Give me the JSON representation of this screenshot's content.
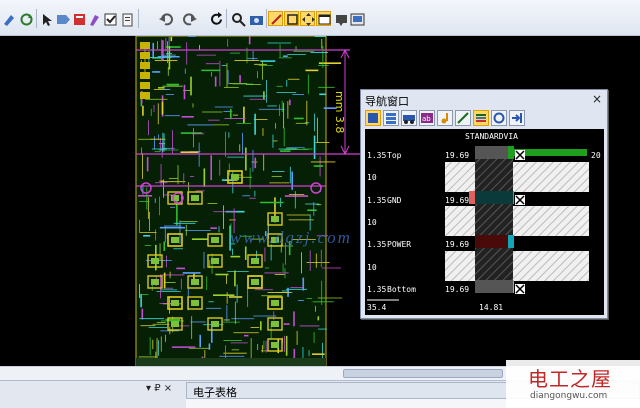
{
  "toolbar": {
    "icons": [
      "snap-icon",
      "refresh-icon",
      "select-arrow-icon",
      "tag-icon",
      "calc-icon",
      "brush-icon",
      "checkbox-icon",
      "clipboard-icon",
      "undo-icon",
      "redo-icon",
      "reload-icon",
      "zoom-icon",
      "camera-icon",
      "route-icon",
      "box-icon",
      "pan-icon",
      "window-icon",
      "highlight-icon",
      "layers-icon"
    ],
    "accent": "#ffd86b"
  },
  "pcb": {
    "dimension_label": "mm 3.8",
    "url_watermark": "www.dgzj.com"
  },
  "nav_window": {
    "title": "导航窗口",
    "close": "×",
    "via_name": "STANDARDVIA",
    "rows": [
      {
        "left": "1.35",
        "name": "Top",
        "value": "19.69",
        "right": "20"
      },
      {
        "left": "10",
        "name": "",
        "value": "",
        "right": ""
      },
      {
        "left": "1.35",
        "name": "GND",
        "value": "19.69",
        "right": ""
      },
      {
        "left": "10",
        "name": "",
        "value": "",
        "right": ""
      },
      {
        "left": "1.35",
        "name": "POWER",
        "value": "19.69",
        "right": ""
      },
      {
        "left": "10",
        "name": "",
        "value": "",
        "right": ""
      },
      {
        "left": "1.35",
        "name": "Bottom",
        "value": "19.69",
        "right": ""
      }
    ],
    "total_left": "35.4",
    "total_mid": "14.81",
    "colors": {
      "top": "#1ea01e",
      "gnd": "#e06060",
      "power": "#11a6b8",
      "bottom": "#c8b400"
    }
  },
  "bottom": {
    "pin_label": "▾ ₽ ×",
    "sheet_title": "电子表格"
  },
  "watermark": {
    "cn": "电工之屋",
    "en": "diangongwu.com"
  }
}
